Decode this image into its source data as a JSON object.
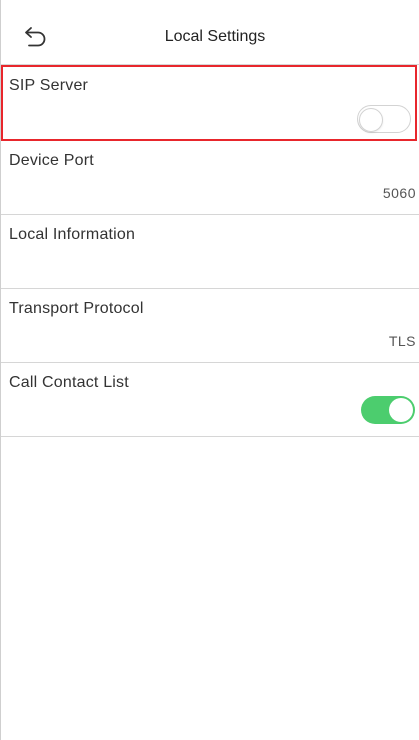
{
  "header": {
    "title": "Local Settings",
    "back_icon": "back-arrow-icon"
  },
  "settings": {
    "sip_server": {
      "label": "SIP Server",
      "enabled": false
    },
    "device_port": {
      "label": "Device Port",
      "value": "5060"
    },
    "local_information": {
      "label": "Local Information"
    },
    "transport_protocol": {
      "label": "Transport Protocol",
      "value": "TLS"
    },
    "call_contact_list": {
      "label": "Call Contact List",
      "enabled": true
    }
  },
  "colors": {
    "selection_border": "#e8262c",
    "toggle_on": "#4ccd6e",
    "toggle_off_border": "#d3d3d3",
    "divider": "#d6d6d6"
  }
}
